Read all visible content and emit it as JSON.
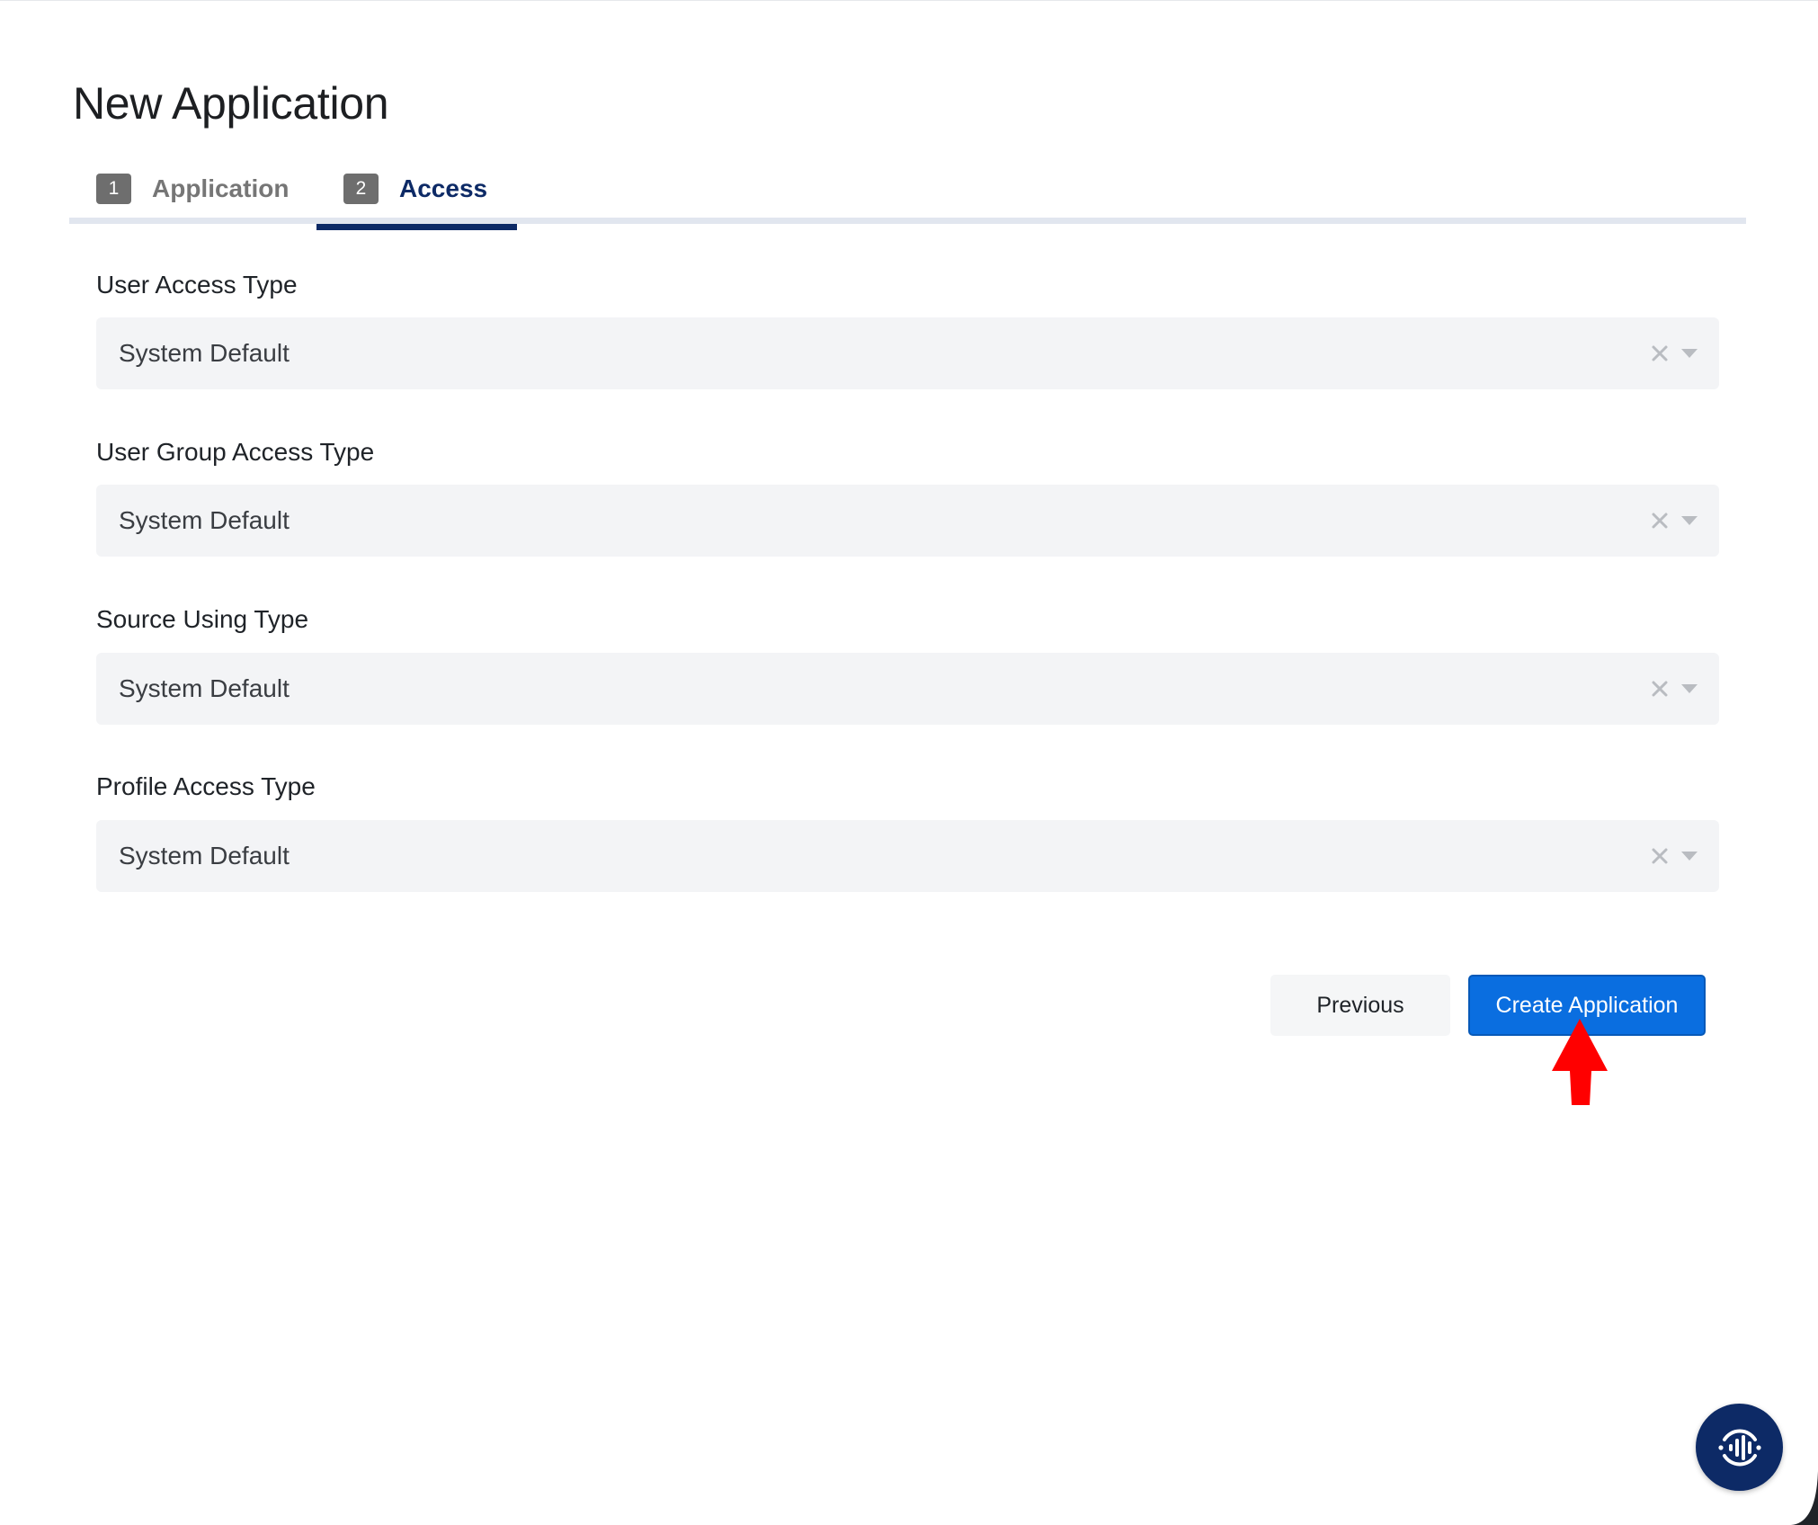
{
  "page": {
    "title": "New Application"
  },
  "tabs": [
    {
      "number": "1",
      "label": "Application",
      "active": false
    },
    {
      "number": "2",
      "label": "Access",
      "active": true
    }
  ],
  "fields": [
    {
      "label": "User Access Type",
      "value": "System Default"
    },
    {
      "label": "User Group Access Type",
      "value": "System Default"
    },
    {
      "label": "Source Using Type",
      "value": "System Default"
    },
    {
      "label": "Profile Access Type",
      "value": "System Default"
    }
  ],
  "actions": {
    "previous_label": "Previous",
    "create_label": "Create Application"
  },
  "icons": {
    "clear": "close-icon",
    "dropdown": "chevron-down-icon",
    "assistant": "voice-assistant-icon",
    "annotation": "red-arrow-pointer"
  },
  "colors": {
    "primary": "#0a6ee0",
    "active_tab": "#0d2a66",
    "fab": "#0d2a66",
    "annotation_arrow": "#ff0000",
    "select_bg": "#f3f4f6"
  }
}
